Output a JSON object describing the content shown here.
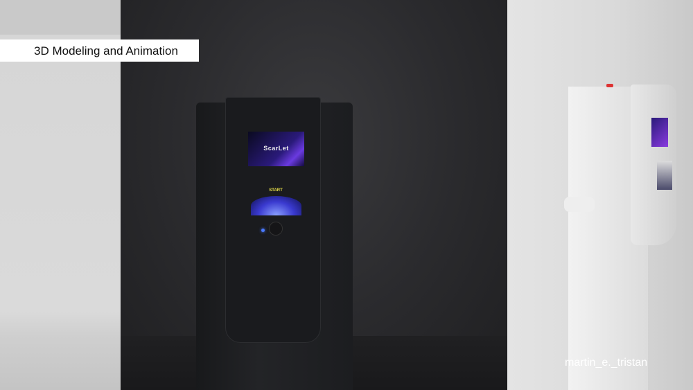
{
  "overlay": {
    "title": "3D Modeling and Animation",
    "credit": "martin_e._tristan"
  },
  "kiosk": {
    "screen_text": "ScarLet",
    "start_label": "START"
  }
}
